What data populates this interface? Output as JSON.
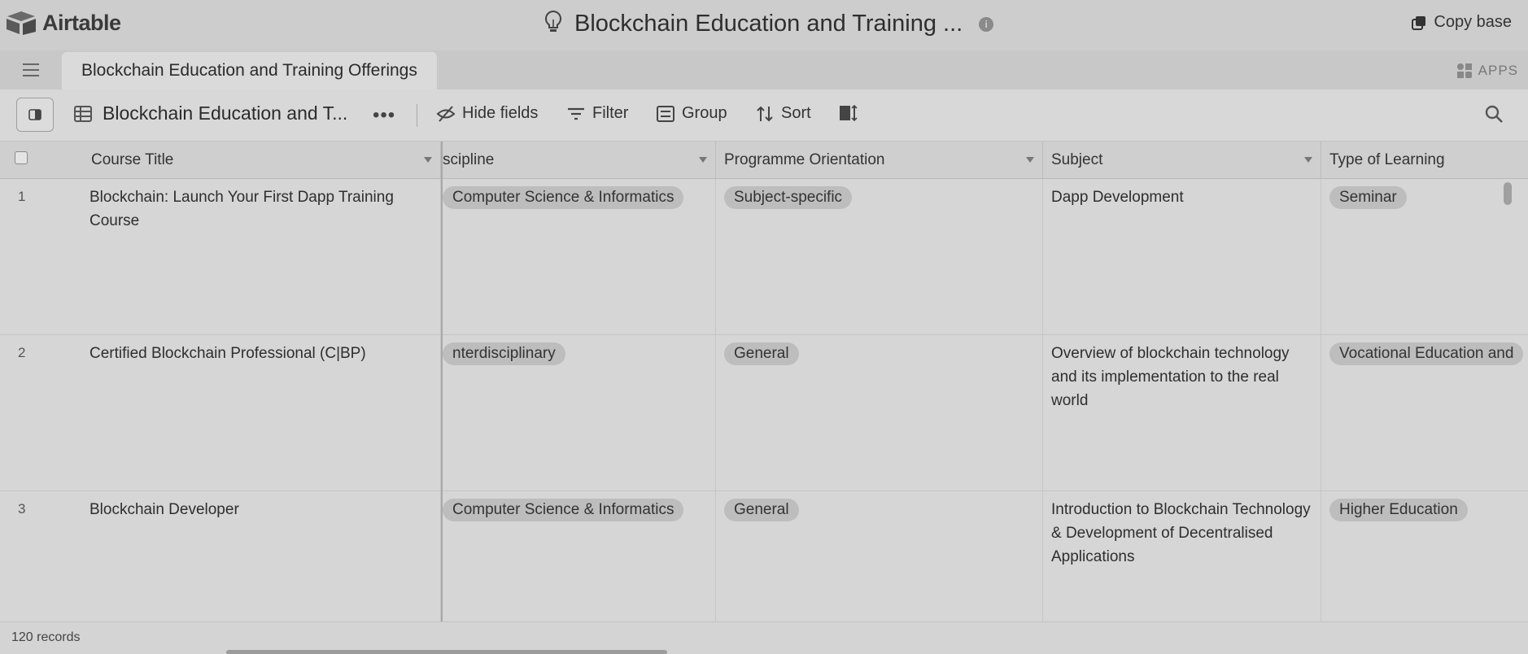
{
  "app": {
    "name": "Airtable"
  },
  "base": {
    "title": "Blockchain Education and Training ...",
    "copy_label": "Copy base",
    "apps_label": "APPS"
  },
  "table_tab": {
    "label": "Blockchain Education and Training Offerings"
  },
  "view": {
    "name": "Blockchain Education and T..."
  },
  "toolbar": {
    "hide_fields": "Hide fields",
    "filter": "Filter",
    "group": "Group",
    "sort": "Sort"
  },
  "columns": [
    "Course Title",
    "scipline",
    "Programme Orientation",
    "Subject",
    "Type of Learning"
  ],
  "rows": [
    {
      "num": "1",
      "title": "Blockchain: Launch Your First Dapp Training Course",
      "discipline": "Computer Science & Informatics",
      "orientation": "Subject-specific",
      "subject": "Dapp Development",
      "type": "Seminar"
    },
    {
      "num": "2",
      "title": "Certified Blockchain Professional (C|BP)",
      "discipline": "nterdisciplinary",
      "orientation": "General",
      "subject": "Overview of blockchain technology and its implementation to the real world",
      "type": "Vocational Education and"
    },
    {
      "num": "3",
      "title": "Blockchain Developer",
      "discipline": "Computer Science & Informatics",
      "orientation": "General",
      "subject": "Introduction to Blockchain Technology & Development of Decentralised Applications",
      "type": "Higher Education"
    }
  ],
  "footer": {
    "record_count": "120 records"
  },
  "colors": {
    "background": "#d2d2d2",
    "pill": "#bdbdbd",
    "text": "#2b2b2b"
  }
}
